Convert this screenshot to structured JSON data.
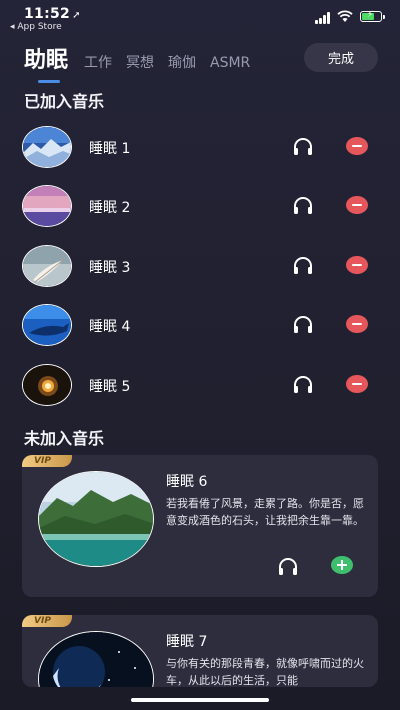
{
  "status_bar": {
    "time": "11:52",
    "back_app": "App Store"
  },
  "tabs": [
    {
      "label": "助眠",
      "active": true
    },
    {
      "label": "工作",
      "active": false
    },
    {
      "label": "冥想",
      "active": false
    },
    {
      "label": "瑜伽",
      "active": false
    },
    {
      "label": "ASMR",
      "active": false
    }
  ],
  "done_button": "完成",
  "added_section": {
    "title": "已加入音乐",
    "items": [
      {
        "name": "睡眠 1",
        "thumb": "snow-mountain"
      },
      {
        "name": "睡眠 2",
        "thumb": "purple-sunset-sea"
      },
      {
        "name": "睡眠 3",
        "thumb": "feather-sky"
      },
      {
        "name": "睡眠 4",
        "thumb": "blue-whale"
      },
      {
        "name": "睡眠 5",
        "thumb": "night-lantern"
      }
    ]
  },
  "not_added_section": {
    "title": "未加入音乐",
    "items": [
      {
        "badge": "VIP",
        "name": "睡眠 6",
        "desc": "若我看倦了风景，走累了路。你是否，愿意变成酒色的石头，让我把余生靠一靠。",
        "art": "green-island"
      },
      {
        "badge": "VIP",
        "name": "睡眠 7",
        "desc": "与你有关的那段青春，就像呼啸而过的火车，从此以后的生活，只能",
        "art": "night-moon"
      }
    ]
  },
  "colors": {
    "remove": "#e5575a",
    "add": "#3fbf6e",
    "active_indicator": "#4a8de6",
    "vip": "#f2cb83"
  },
  "icons": {
    "listen": "headphones-icon",
    "remove": "minus-circle-icon",
    "add": "plus-circle-icon"
  }
}
